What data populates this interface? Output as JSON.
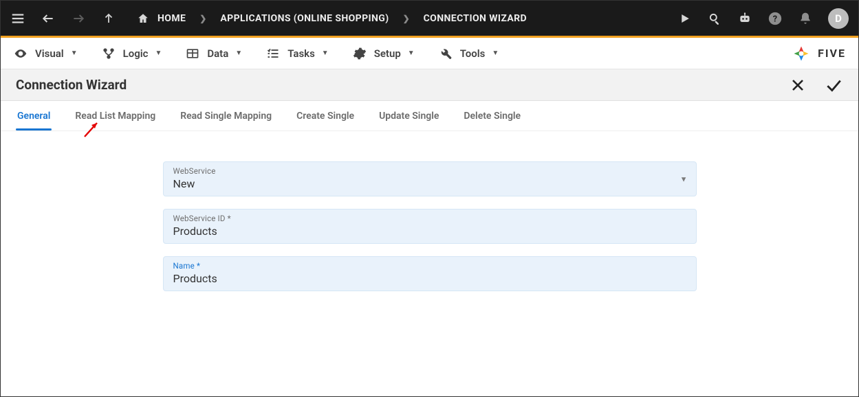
{
  "topbar": {
    "home_label": "HOME",
    "app_label": "APPLICATIONS (ONLINE SHOPPING)",
    "page_label": "CONNECTION WIZARD",
    "avatar_initial": "D"
  },
  "menubar": {
    "items": [
      {
        "label": "Visual"
      },
      {
        "label": "Logic"
      },
      {
        "label": "Data"
      },
      {
        "label": "Tasks"
      },
      {
        "label": "Setup"
      },
      {
        "label": "Tools"
      }
    ],
    "brand": "FIVE"
  },
  "page": {
    "title": "Connection Wizard"
  },
  "tabs": [
    {
      "label": "General",
      "active": true
    },
    {
      "label": "Read List Mapping"
    },
    {
      "label": "Read Single Mapping"
    },
    {
      "label": "Create Single"
    },
    {
      "label": "Update Single"
    },
    {
      "label": "Delete Single"
    }
  ],
  "form": {
    "webservice": {
      "label": "WebService",
      "value": "New"
    },
    "webservice_id": {
      "label": "WebService ID *",
      "value": "Products"
    },
    "name": {
      "label": "Name *",
      "value": "Products"
    }
  }
}
